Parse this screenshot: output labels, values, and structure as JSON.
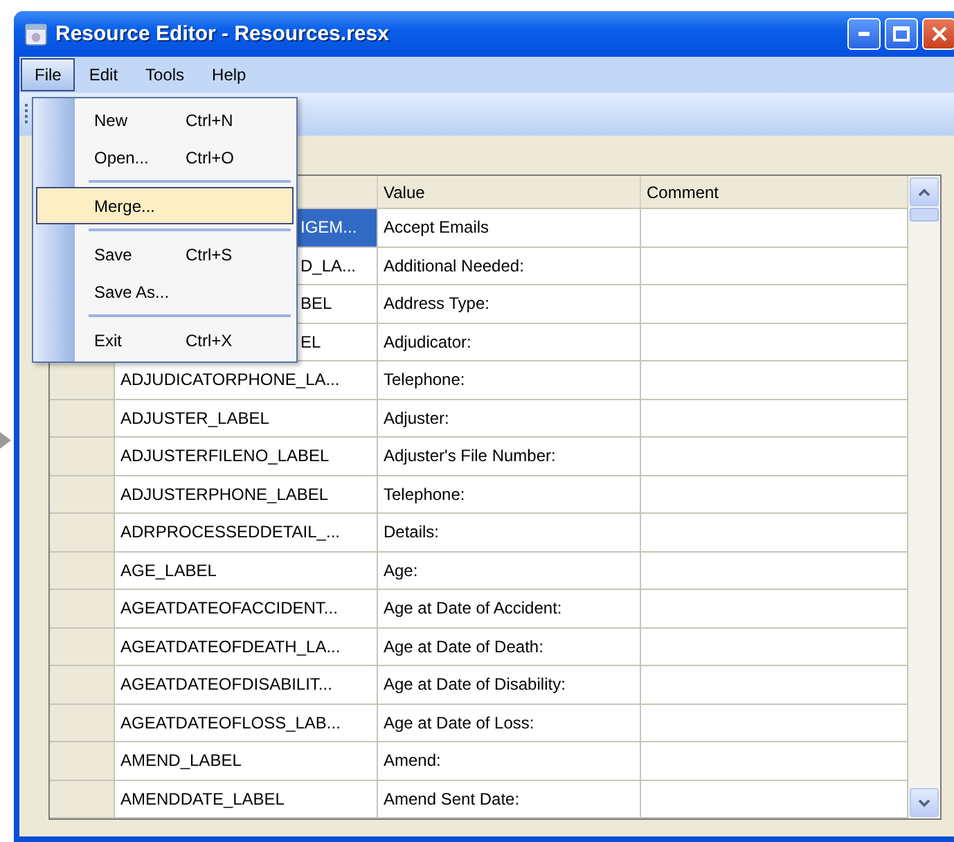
{
  "window": {
    "title": "Resource Editor - Resources.resx"
  },
  "menu_bar": [
    {
      "label": "File",
      "selected": true
    },
    {
      "label": "Edit",
      "selected": false
    },
    {
      "label": "Tools",
      "selected": false
    },
    {
      "label": "Help",
      "selected": false
    }
  ],
  "file_menu": [
    {
      "kind": "item",
      "label": "New",
      "shortcut": "Ctrl+N",
      "selected": false
    },
    {
      "kind": "item",
      "label": "Open...",
      "shortcut": "Ctrl+O",
      "selected": false
    },
    {
      "kind": "separator"
    },
    {
      "kind": "item",
      "label": "Merge...",
      "selected": true
    },
    {
      "kind": "separator"
    },
    {
      "kind": "item",
      "label": "Save",
      "shortcut": "Ctrl+S",
      "selected": false
    },
    {
      "kind": "item",
      "label": "Save As...",
      "selected": false
    },
    {
      "kind": "separator"
    },
    {
      "kind": "item",
      "label": "Exit",
      "shortcut": "Ctrl+X",
      "selected": false
    }
  ],
  "table": {
    "columns": [
      "Value",
      "Comment"
    ],
    "rows": [
      {
        "name": "IGEM...",
        "clipped": true,
        "value": "Accept Emails",
        "selected": true
      },
      {
        "name": "D_LA...",
        "clipped": true,
        "value": "Additional Needed:",
        "selected": false
      },
      {
        "name": "BEL",
        "clipped": true,
        "value": "Address Type:",
        "selected": false
      },
      {
        "name": "EL",
        "clipped": true,
        "value": "Adjudicator:",
        "selected": false
      },
      {
        "name": "ADJUDICATORPHONE_LA...",
        "clipped": false,
        "value": "Telephone:",
        "selected": false
      },
      {
        "name": "ADJUSTER_LABEL",
        "clipped": false,
        "value": "Adjuster:",
        "selected": false
      },
      {
        "name": "ADJUSTERFILENO_LABEL",
        "clipped": false,
        "value": "Adjuster's File Number:",
        "selected": false
      },
      {
        "name": "ADJUSTERPHONE_LABEL",
        "clipped": false,
        "value": "Telephone:",
        "selected": false
      },
      {
        "name": "ADRPROCESSEDDETAIL_...",
        "clipped": false,
        "value": "Details:",
        "selected": false
      },
      {
        "name": "AGE_LABEL",
        "clipped": false,
        "value": "Age:",
        "selected": false
      },
      {
        "name": "AGEATDATEOFACCIDENT...",
        "clipped": false,
        "value": "Age at Date of Accident:",
        "selected": false
      },
      {
        "name": "AGEATDATEOFDEATH_LA...",
        "clipped": false,
        "value": "Age at Date of Death:",
        "selected": false
      },
      {
        "name": "AGEATDATEOFDISABILIT...",
        "clipped": false,
        "value": "Age at Date of Disability:",
        "selected": false
      },
      {
        "name": "AGEATDATEOFLOSS_LAB...",
        "clipped": false,
        "value": "Age at Date of Loss:",
        "selected": false
      },
      {
        "name": "AMEND_LABEL",
        "clipped": false,
        "value": "Amend:",
        "selected": false
      },
      {
        "name": "AMENDDATE_LABEL",
        "clipped": false,
        "value": "Amend Sent Date:",
        "selected": false
      }
    ]
  }
}
